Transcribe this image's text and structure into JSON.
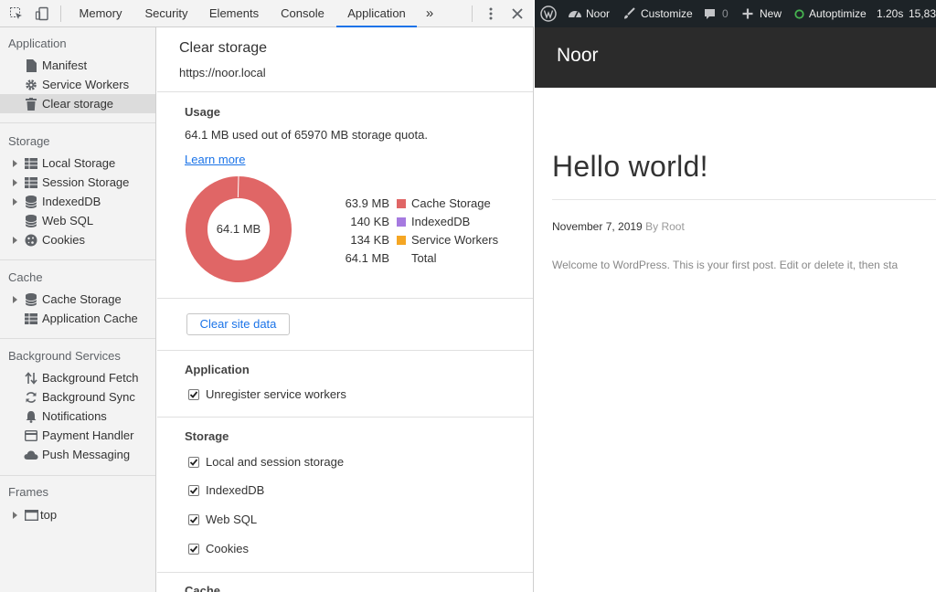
{
  "devtools": {
    "tabs": [
      "Memory",
      "Security",
      "Elements",
      "Console",
      "Application"
    ],
    "active_tab": "Application",
    "more_tabs": "»",
    "sidebar": {
      "application": {
        "title": "Application",
        "items": [
          "Manifest",
          "Service Workers",
          "Clear storage"
        ]
      },
      "storage": {
        "title": "Storage",
        "items": [
          "Local Storage",
          "Session Storage",
          "IndexedDB",
          "Web SQL",
          "Cookies"
        ]
      },
      "cache": {
        "title": "Cache",
        "items": [
          "Cache Storage",
          "Application Cache"
        ]
      },
      "background": {
        "title": "Background Services",
        "items": [
          "Background Fetch",
          "Background Sync",
          "Notifications",
          "Payment Handler",
          "Push Messaging"
        ]
      },
      "frames": {
        "title": "Frames",
        "items": [
          "top"
        ]
      }
    },
    "main": {
      "title": "Clear storage",
      "origin": "https://noor.local",
      "usage": {
        "heading": "Usage",
        "summary": "64.1 MB used out of 65970 MB storage quota.",
        "learn_more": "Learn more",
        "donut_label": "64.1 MB",
        "legend": [
          {
            "size": "63.9 MB",
            "label": "Cache Storage",
            "color": "#e06666"
          },
          {
            "size": "140 KB",
            "label": "IndexedDB",
            "color": "#a67ae0"
          },
          {
            "size": "134 KB",
            "label": "Service Workers",
            "color": "#f5a623"
          },
          {
            "size": "64.1 MB",
            "label": "Total",
            "color": ""
          }
        ]
      },
      "clear_button": "Clear site data",
      "application_section": {
        "heading": "Application",
        "options": [
          "Unregister service workers"
        ]
      },
      "storage_section": {
        "heading": "Storage",
        "options": [
          "Local and session storage",
          "IndexedDB",
          "Web SQL",
          "Cookies"
        ]
      },
      "cache_section": {
        "heading": "Cache"
      }
    }
  },
  "site": {
    "adminbar": {
      "site_name": "Noor",
      "customize": "Customize",
      "comments": "0",
      "new": "New",
      "autoptimize": "Autoptimize",
      "timing": "1.20s",
      "queries": "15,83"
    },
    "header_title": "Noor",
    "post": {
      "title": "Hello world!",
      "date": "November 7, 2019",
      "by": "By",
      "author": "Root",
      "excerpt": "Welcome to WordPress. This is your first post. Edit or delete it, then sta"
    }
  },
  "colors": {
    "accent": "#1a73e8",
    "cache_storage": "#e06666",
    "indexeddb": "#a67ae0",
    "service_workers": "#f5a623",
    "wp_bar": "#1d2327",
    "site_header": "#2b2b2b"
  }
}
